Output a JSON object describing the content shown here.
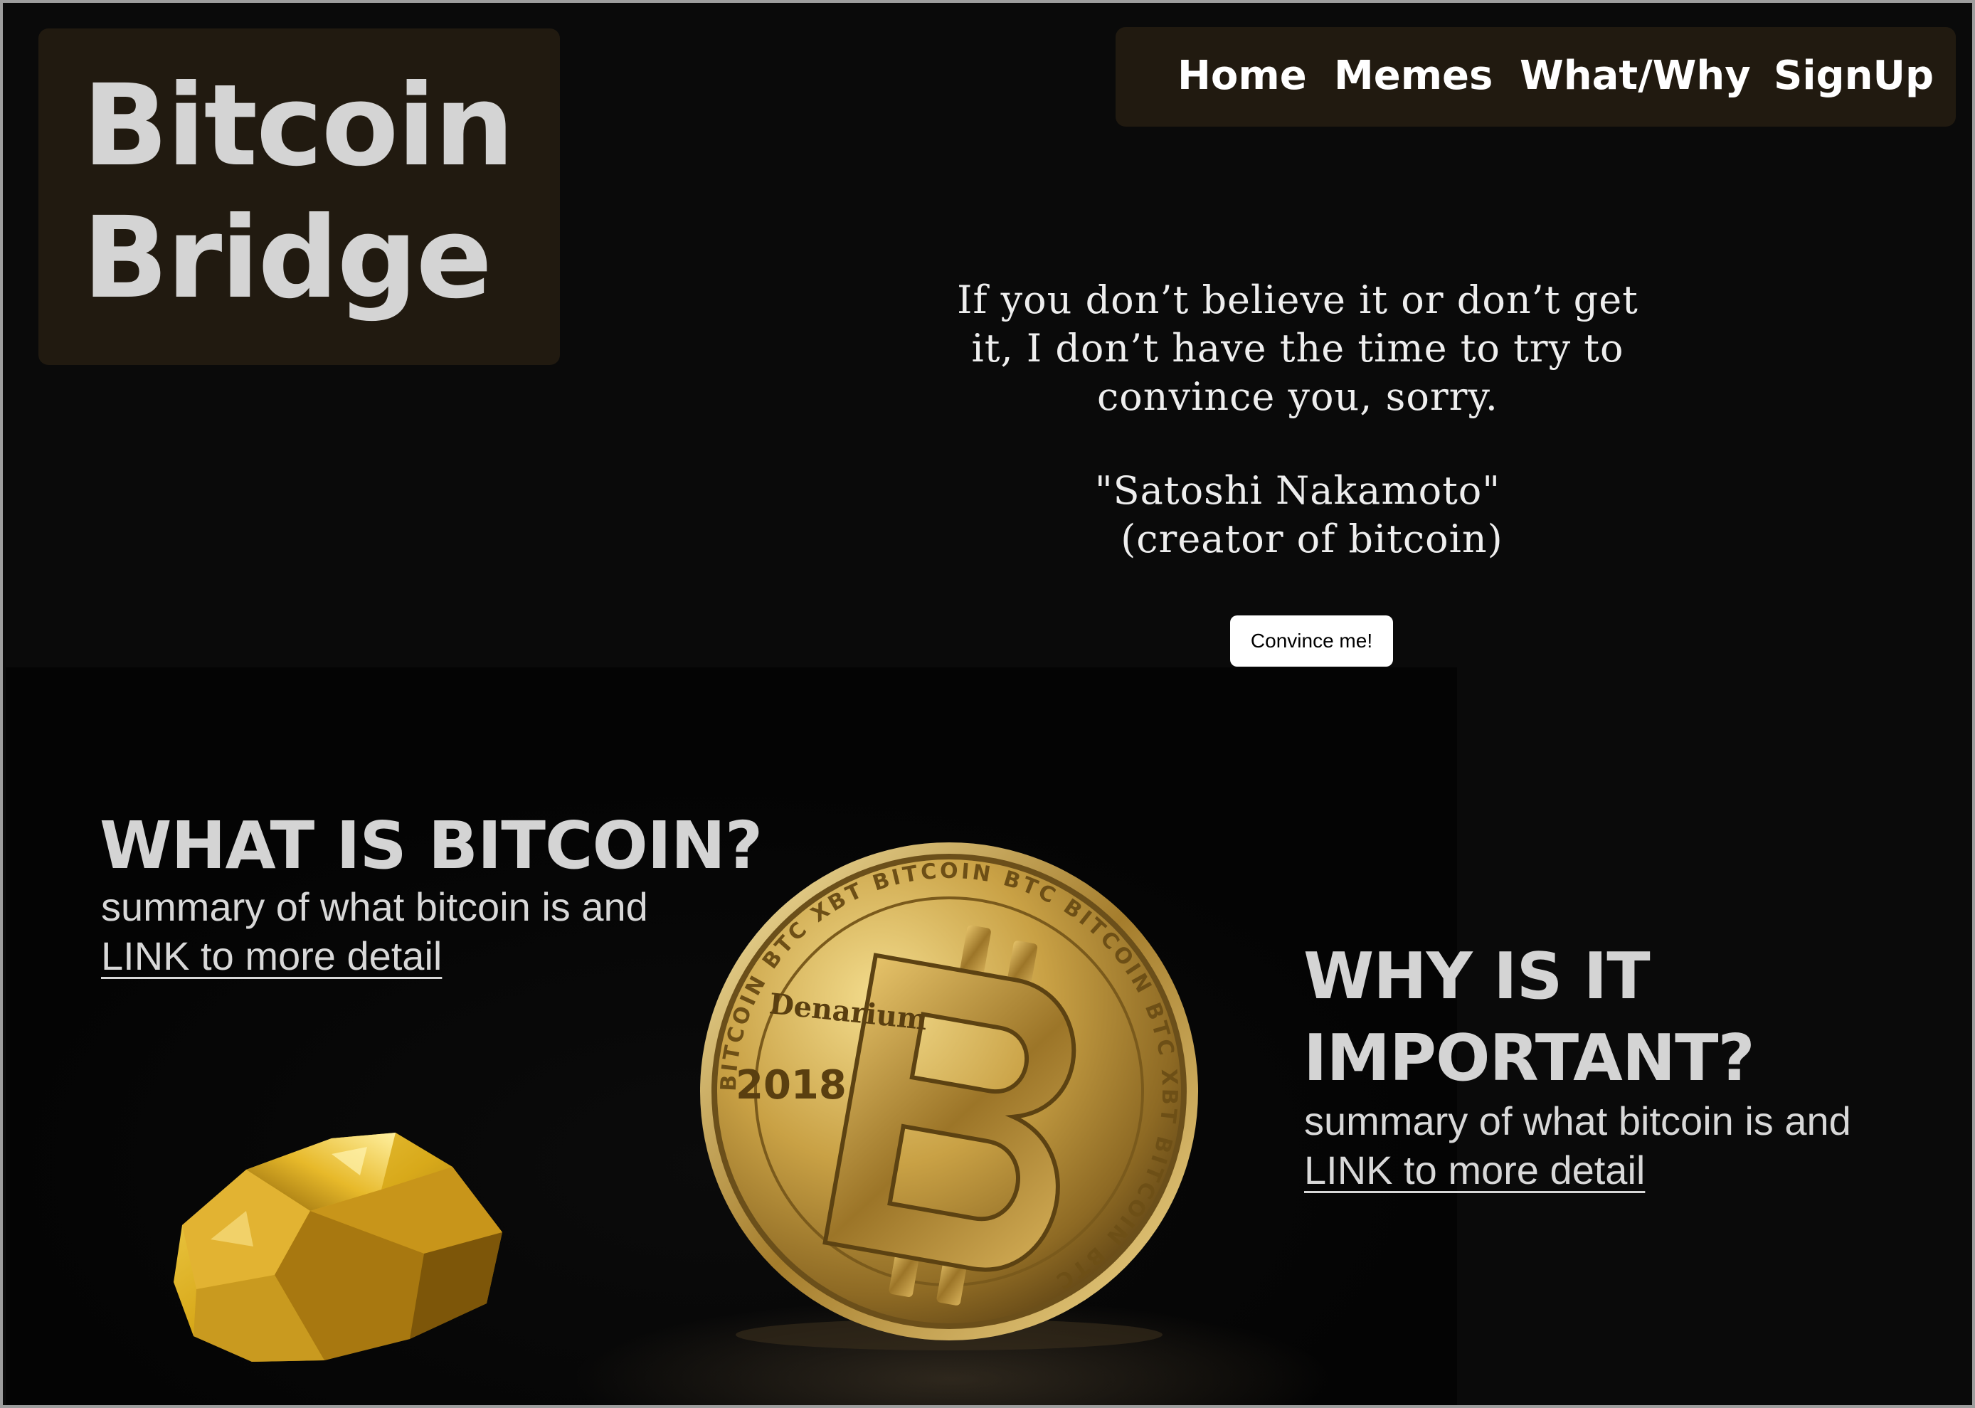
{
  "brand": {
    "title": "Bitcoin\nBridge"
  },
  "nav": {
    "items": [
      {
        "label": "Home"
      },
      {
        "label": "Memes"
      },
      {
        "label": "What/Why"
      },
      {
        "label": "SignUp"
      }
    ]
  },
  "hero": {
    "quote": "If you don’t believe it or don’t get\nit, I don’t have the time to try to\nconvince you, sorry.",
    "author": "\"Satoshi Nakamoto\"",
    "caption": "(creator of bitcoin)",
    "button_label": "Convince me!"
  },
  "what_section": {
    "heading": "WHAT IS BITCOIN?",
    "summary": "summary of what bitcoin is and",
    "link_label": "LINK to more detail"
  },
  "why_section": {
    "heading_line1": "WHY IS IT",
    "heading_line2": "IMPORTANT?",
    "summary": "summary of what bitcoin is and",
    "link_label": "LINK to more detail"
  },
  "illustrations": {
    "coin": {
      "icon": "bitcoin-coin-icon",
      "year": "2018",
      "brand": "Denarium",
      "ring_text": "BITCOIN BTC XBT BITCOIN BTC BITCOIN BTC XBT BITCOIN BTC"
    },
    "nugget": {
      "icon": "gold-nugget-icon"
    }
  },
  "colors": {
    "background": "#0a0a0a",
    "panel": "#211a10",
    "text_light": "#d4d4d4",
    "gold": "#c9a227",
    "button_bg": "#ffffff"
  }
}
